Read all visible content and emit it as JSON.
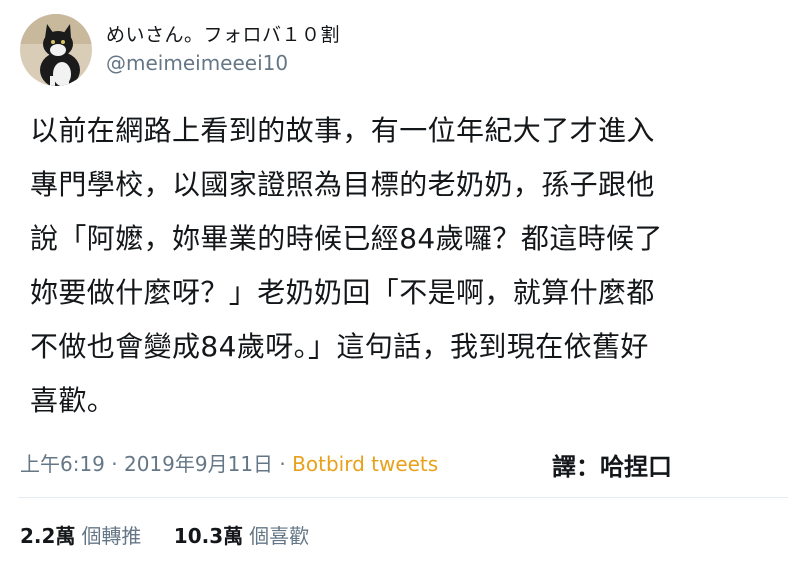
{
  "user": {
    "display_name": "めいさん。フォロバ１０割",
    "handle": "@meimeimeeei10",
    "avatar_icon": "cat-avatar"
  },
  "tweet": {
    "lines": [
      "以前在網路上看到的故事，有一位年紀大了才進入",
      "專門學校，以國家證照為目標的老奶奶，孫子跟他",
      "說「阿嬤，妳畢業的時候已經84歲囉？都這時候了",
      "妳要做什麼呀？」老奶奶回「不是啊，就算什麼都",
      "不做也會變成84歲呀。」這句話，我到現在依舊好",
      "喜歡。"
    ]
  },
  "meta": {
    "timestamp": "上午6:19 · 2019年9月11日",
    "separator": " · ",
    "source": "Botbird tweets",
    "translator": "譯：哈捏口"
  },
  "stats": {
    "retweets_count": "2.2萬",
    "retweets_label": "個轉推",
    "likes_count": "10.3萬",
    "likes_label": "個喜歡"
  },
  "colors": {
    "text": "#14171a",
    "secondary": "#657786",
    "source_link": "#e8a11a",
    "divider": "#e6ecf0"
  }
}
